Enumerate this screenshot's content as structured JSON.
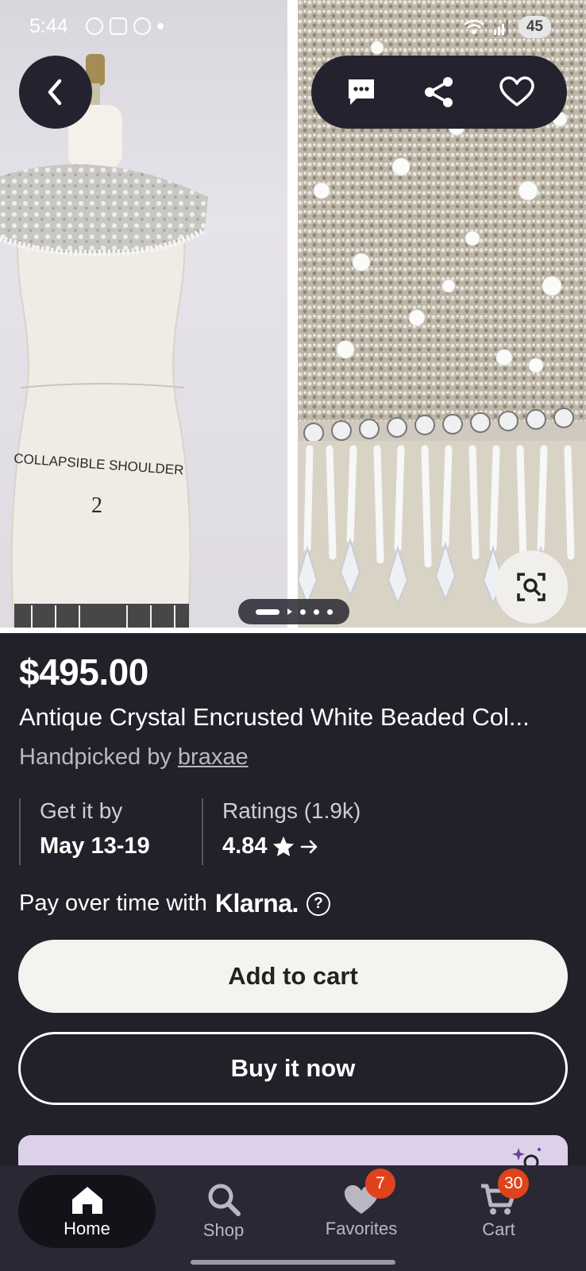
{
  "status_bar": {
    "time": "5:44",
    "battery": "45"
  },
  "gallery": {
    "mannequin_text": "COLLAPSIBLE SHOULDER",
    "mannequin_size": "2",
    "page_count": 5,
    "current_page": 1
  },
  "product": {
    "price": "$495.00",
    "title": "Antique Crystal Encrusted White Beaded Col...",
    "handpicked_prefix": "Handpicked by",
    "curator": "braxae",
    "delivery_label": "Get it by",
    "delivery_value": "May 13-19",
    "ratings_label": "Ratings (1.9k)",
    "rating_value": "4.84",
    "klarna_text": "Pay over time with",
    "klarna_brand": "Klarna."
  },
  "buttons": {
    "add_to_cart": "Add to cart",
    "buy_now": "Buy it now"
  },
  "icons": {
    "back": "chevron-left-icon",
    "message": "message-icon",
    "share": "share-icon",
    "favorite": "heart-outline-icon",
    "visual_search": "visual-search-icon",
    "help": "question-circle-icon",
    "star": "star-icon",
    "arrow": "arrow-right-icon"
  },
  "nav": {
    "items": [
      {
        "label": "Home",
        "icon": "home-icon",
        "active": true
      },
      {
        "label": "Shop",
        "icon": "search-icon",
        "active": false
      },
      {
        "label": "Favorites",
        "icon": "heart-icon",
        "active": false,
        "badge": "7"
      },
      {
        "label": "Cart",
        "icon": "cart-icon",
        "active": false,
        "badge": "30"
      }
    ]
  },
  "colors": {
    "background": "#222029",
    "badge": "#e0431b",
    "primary_button": "#f5f3ef",
    "promo": "#ddd1ea"
  }
}
